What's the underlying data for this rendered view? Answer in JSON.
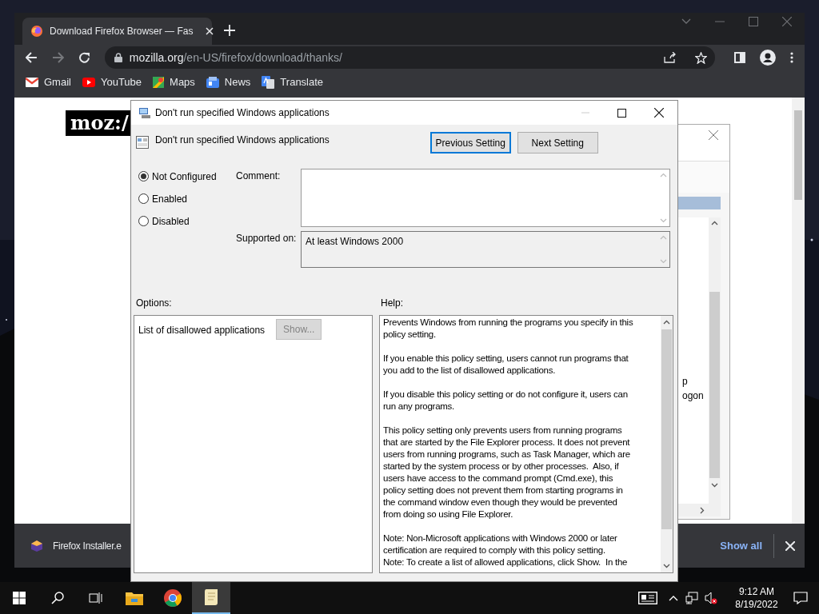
{
  "browser": {
    "tab": {
      "title": "Download Firefox Browser — Fas"
    },
    "address": {
      "host": "mozilla.org",
      "path": "/en-US/firefox/download/thanks/"
    },
    "bookmarks": [
      {
        "label": "Gmail",
        "kind": "mail"
      },
      {
        "label": "YouTube",
        "kind": "video"
      },
      {
        "label": "Maps",
        "kind": "maps"
      },
      {
        "label": "News",
        "kind": "news"
      },
      {
        "label": "Translate",
        "kind": "translate"
      }
    ],
    "page": {
      "logo": "moz:/"
    },
    "download_bar": {
      "file": "Firefox Installer.e",
      "show_all": "Show all"
    }
  },
  "background_window": {
    "texts": [
      "p",
      "ogon"
    ]
  },
  "dialog": {
    "title": "Don't run specified Windows applications",
    "setting_name": "Don't run specified Windows applications",
    "buttons": [
      {
        "label": "Previous Setting",
        "focused": true
      },
      {
        "label": "Next Setting",
        "focused": false
      }
    ],
    "radios": [
      {
        "label": "Not Configured",
        "selected": true
      },
      {
        "label": "Enabled",
        "selected": false
      },
      {
        "label": "Disabled",
        "selected": false
      }
    ],
    "comment_label": "Comment:",
    "supported_label": "Supported on:",
    "supported_value": "At least Windows 2000",
    "options_label": "Options:",
    "help_label": "Help:",
    "option": {
      "label": "List of disallowed applications",
      "button": "Show...",
      "disabled": true
    },
    "help_paragraphs": [
      [
        "Prevents Windows from running the programs you specify in this",
        "policy setting."
      ],
      [
        "If you enable this policy setting, users cannot run programs that",
        "you add to the list of disallowed applications."
      ],
      [
        "If you disable this policy setting or do not configure it, users can",
        "run any programs."
      ],
      [
        "This policy setting only prevents users from running programs",
        "that are started by the File Explorer process. It does not prevent",
        "users from running programs, such as Task Manager, which are",
        "started by the system process or by other processes.  Also, if",
        "users have access to the command prompt (Cmd.exe), this",
        "policy setting does not prevent them from starting programs in",
        "the command window even though they would be prevented",
        "from doing so using File Explorer."
      ],
      [
        "Note: Non-Microsoft applications with Windows 2000 or later",
        "certification are required to comply with this policy setting.",
        "Note: To create a list of allowed applications, click Show.  In the"
      ]
    ]
  },
  "taskbar": {
    "apps": [
      {
        "kind": "start",
        "active": false
      },
      {
        "kind": "search",
        "active": false
      },
      {
        "kind": "taskview",
        "active": false
      },
      {
        "kind": "explorer",
        "active": false
      },
      {
        "kind": "browser",
        "active": false
      },
      {
        "kind": "notepad",
        "active": true
      }
    ],
    "time": "9:12 AM",
    "date": "8/19/2022"
  }
}
